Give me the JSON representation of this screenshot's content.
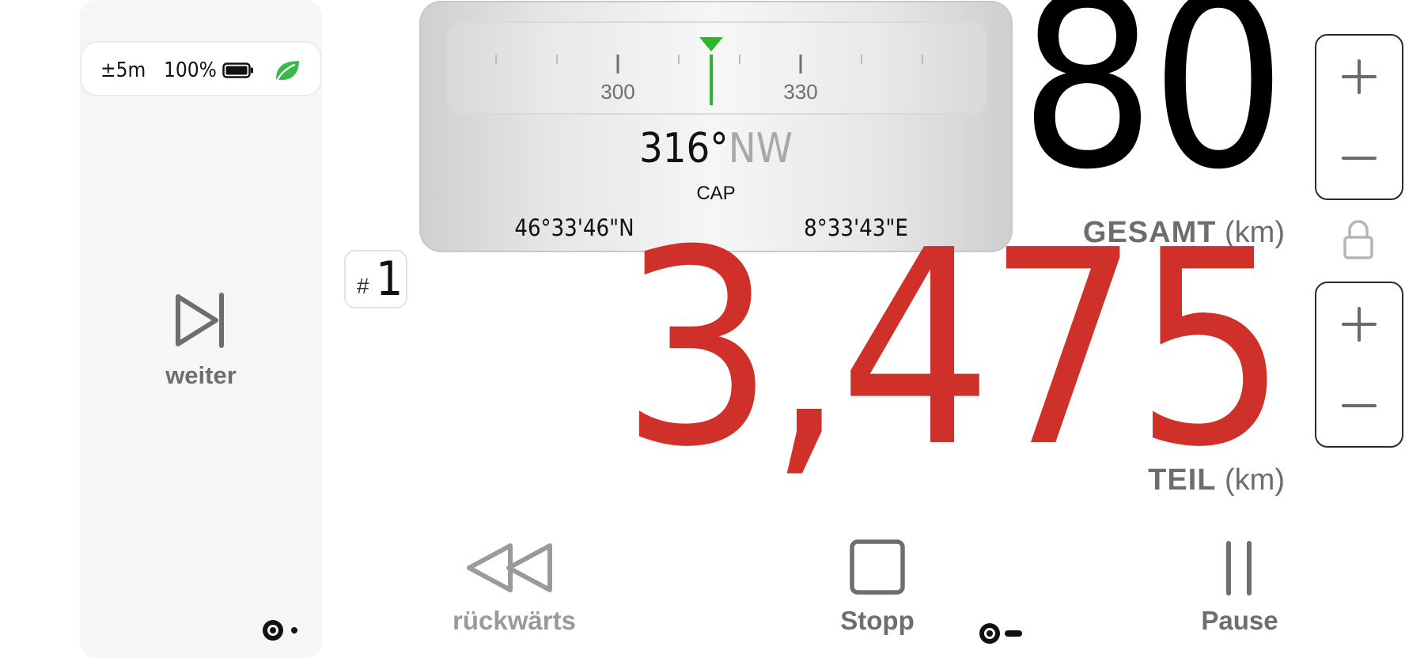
{
  "status": {
    "gps_accuracy": "±5m",
    "battery_percent": "100%",
    "battery_icon": "battery-full-icon",
    "eco_icon": "leaf-icon",
    "eco_color": "#3cb84a"
  },
  "left_panel": {
    "next_label": "weiter",
    "next_icon": "skip-forward-icon"
  },
  "compass": {
    "tick_labels": [
      "300",
      "330"
    ],
    "heading_degrees": "316°",
    "heading_direction": "NW",
    "heading_label": "CAP",
    "latitude": "46°33'46\"N",
    "longitude": "8°33'43\"E",
    "marker_color": "#2db52d"
  },
  "lap": {
    "prefix": "#",
    "number": "1"
  },
  "odometer": {
    "total_value": "80",
    "total_label": "GESAMT",
    "total_unit": "(km)",
    "partial_value": "3,475",
    "partial_label": "TEIL",
    "partial_unit": "(km)",
    "partial_color": "#d0302a"
  },
  "steppers": {
    "plus_icon": "plus-icon",
    "minus_icon": "minus-icon",
    "lock_icon": "lock-icon"
  },
  "controls": {
    "back_label": "rückwärts",
    "stop_label": "Stopp",
    "pause_label": "Pause"
  }
}
